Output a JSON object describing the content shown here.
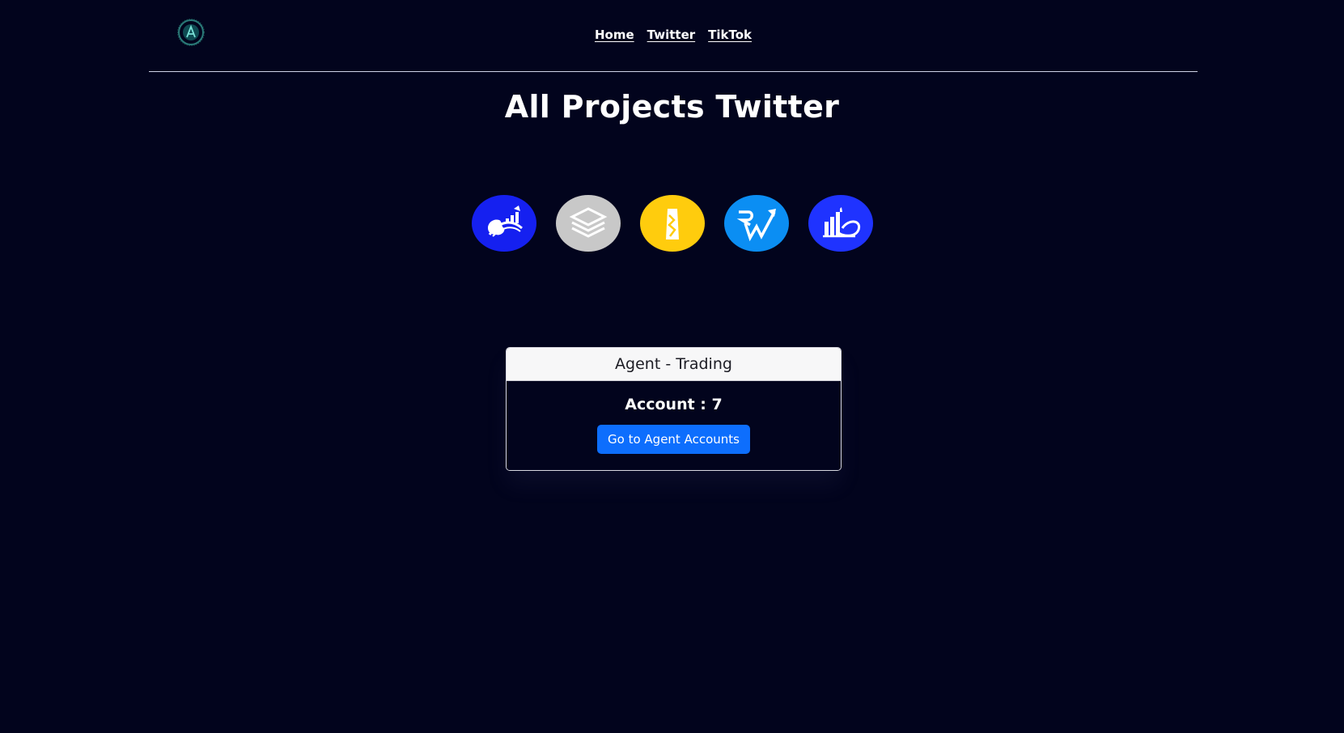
{
  "nav": {
    "home_label": "Home",
    "twitter_label": "Twitter",
    "tiktok_label": "TikTok"
  },
  "page": {
    "title": "All Projects Twitter"
  },
  "projects": [
    {
      "icon": "globe-growth-chart-icon",
      "color": "#1520f0"
    },
    {
      "icon": "stacked-layers-icon",
      "color": "#c8c8c8"
    },
    {
      "icon": "building-bar-icon",
      "color": "#ffcc0d"
    },
    {
      "icon": "rw-arrow-chart-icon",
      "color": "#0b8ef3"
    },
    {
      "icon": "city-chart-icon",
      "color": "#1f33ff"
    }
  ],
  "card": {
    "header": "Agent - Trading",
    "account_label": "Account : 7",
    "button_label": "Go to Agent Accounts"
  }
}
